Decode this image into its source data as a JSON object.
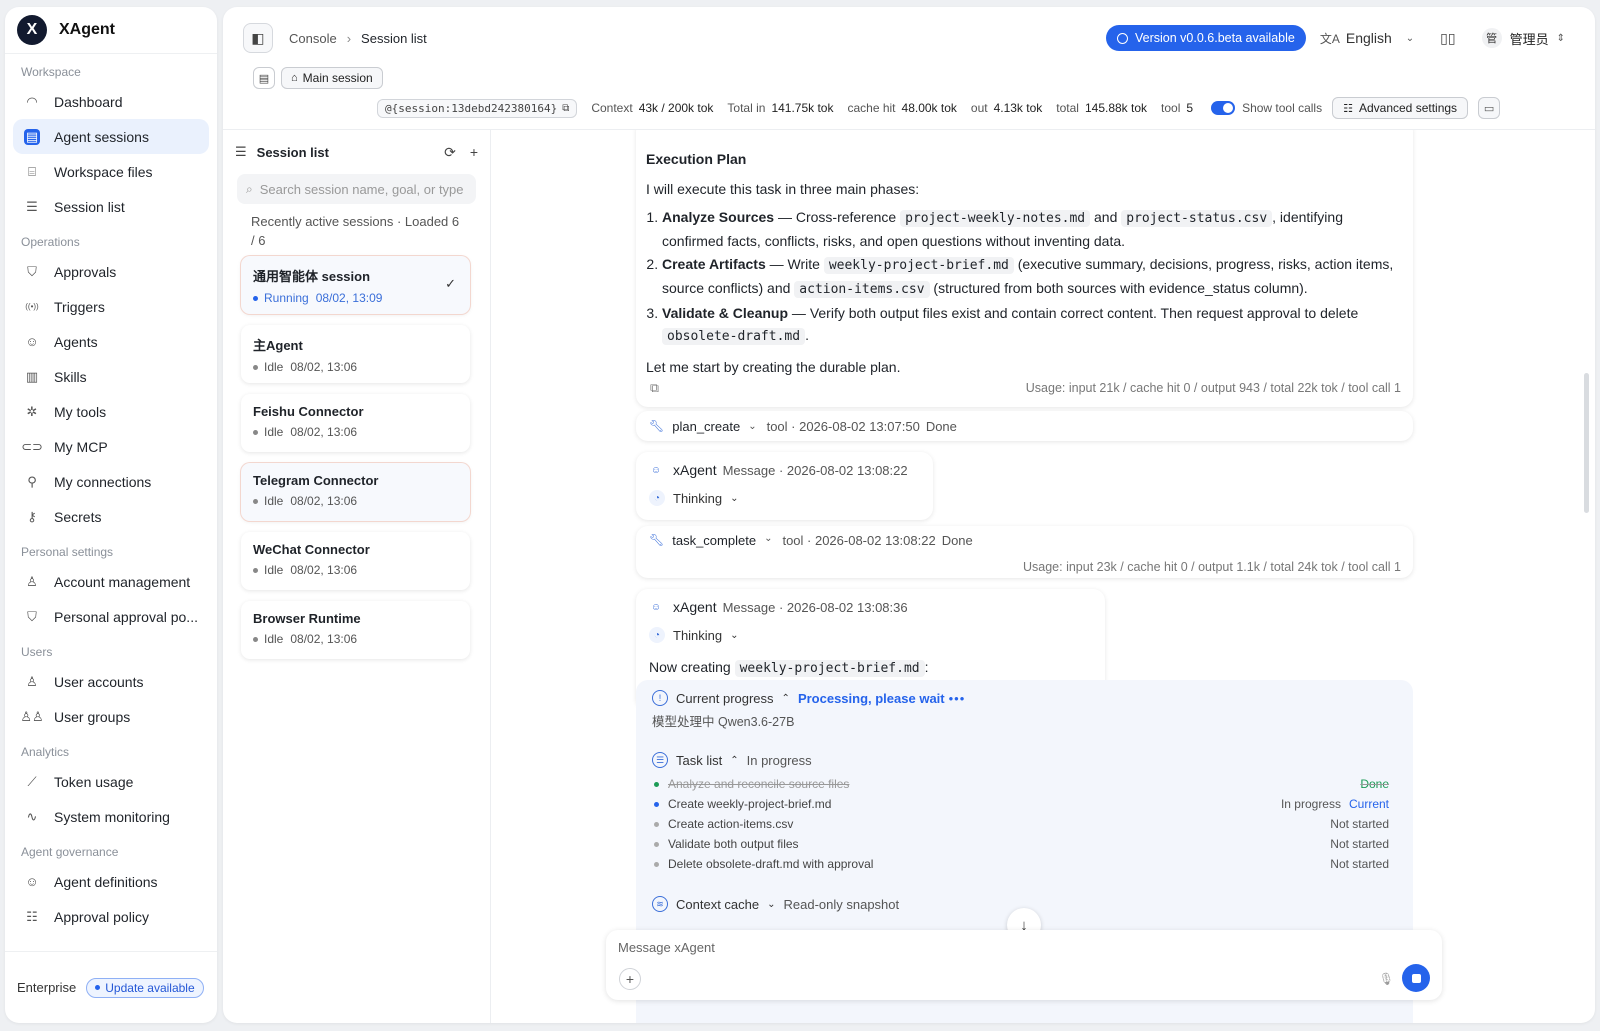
{
  "brand": {
    "name": "XAgent",
    "logo": "X"
  },
  "sidebar": {
    "sections": [
      {
        "title": "Workspace",
        "items": [
          {
            "label": "Dashboard",
            "icon": "dashboard-icon",
            "glyph": "◠"
          },
          {
            "label": "Agent sessions",
            "icon": "chat-icon",
            "glyph": "▤",
            "active": true
          },
          {
            "label": "Workspace files",
            "icon": "drive-icon",
            "glyph": "⌸"
          },
          {
            "label": "Session list",
            "icon": "list-icon",
            "glyph": "☰"
          }
        ]
      },
      {
        "title": "Operations",
        "items": [
          {
            "label": "Approvals",
            "icon": "shield-icon",
            "glyph": "⛉"
          },
          {
            "label": "Triggers",
            "icon": "broadcast-icon",
            "glyph": "((•))"
          },
          {
            "label": "Agents",
            "icon": "robot-icon",
            "glyph": "☺"
          },
          {
            "label": "Skills",
            "icon": "book-icon",
            "glyph": "▥"
          },
          {
            "label": "My tools",
            "icon": "tools-icon",
            "glyph": "✲"
          },
          {
            "label": "My MCP",
            "icon": "link-icon",
            "glyph": "⊂⊃"
          },
          {
            "label": "My connections",
            "icon": "plug-icon",
            "glyph": "⚲"
          },
          {
            "label": "Secrets",
            "icon": "key-icon",
            "glyph": "⚷"
          }
        ]
      },
      {
        "title": "Personal settings",
        "items": [
          {
            "label": "Account management",
            "icon": "user-gear-icon",
            "glyph": "♙"
          },
          {
            "label": "Personal approval po...",
            "icon": "shield-check-icon",
            "glyph": "⛉"
          }
        ]
      },
      {
        "title": "Users",
        "items": [
          {
            "label": "User accounts",
            "icon": "user-icon",
            "glyph": "♙"
          },
          {
            "label": "User groups",
            "icon": "users-icon",
            "glyph": "♙♙"
          }
        ]
      },
      {
        "title": "Analytics",
        "items": [
          {
            "label": "Token usage",
            "icon": "chart-line-icon",
            "glyph": "⟋"
          },
          {
            "label": "System monitoring",
            "icon": "pulse-icon",
            "glyph": "∿"
          }
        ]
      },
      {
        "title": "Agent governance",
        "items": [
          {
            "label": "Agent definitions",
            "icon": "bot-icon",
            "glyph": "☺"
          },
          {
            "label": "Approval policy",
            "icon": "sliders-icon",
            "glyph": "☷"
          }
        ]
      }
    ],
    "footer": {
      "edition": "Enterprise",
      "update": "Update available"
    }
  },
  "topbar": {
    "breadcrumb": [
      "Console",
      "Session list"
    ],
    "version_button": "Version v0.0.6.beta available",
    "language": "English",
    "user_avatar": "管",
    "user_name": "管理员"
  },
  "subbar": {
    "main_session": "Main session"
  },
  "stats": {
    "session_id": "@{session:13debd242380164}",
    "context_label": "Context",
    "context_value": "43k / 200k tok",
    "total_in_label": "Total  in",
    "total_in_value": "141.75k tok",
    "cache_label": "cache hit",
    "cache_value": "48.00k tok",
    "out_label": "out",
    "out_value": "4.13k tok",
    "total_label": "total",
    "total_value": "145.88k tok",
    "tool_label": "tool",
    "tool_value": "5",
    "show_tool_calls": "Show tool calls",
    "advanced": "Advanced settings"
  },
  "sessions": {
    "title": "Session list",
    "search_placeholder": "Search session name, goal, or type",
    "recent": "Recently active sessions · Loaded 6 / 6",
    "items": [
      {
        "name": "通用智能体 session",
        "status": "Running",
        "time": "08/02, 13:09",
        "running": true,
        "active": true
      },
      {
        "name": "主Agent",
        "status": "Idle",
        "time": "08/02, 13:06"
      },
      {
        "name": "Feishu Connector",
        "status": "Idle",
        "time": "08/02, 13:06"
      },
      {
        "name": "Telegram Connector",
        "status": "Idle",
        "time": "08/02, 13:06",
        "hover": true
      },
      {
        "name": "WeChat Connector",
        "status": "Idle",
        "time": "08/02, 13:06"
      },
      {
        "name": "Browser Runtime",
        "status": "Idle",
        "time": "08/02, 13:06"
      }
    ]
  },
  "chat": {
    "plan": {
      "title": "Execution Plan",
      "intro": "I will execute this task in three main phases:",
      "steps": [
        {
          "head": "Analyze Sources",
          "parts": [
            " — Cross-reference ",
            "project-weekly-notes.md",
            " and ",
            "project-status.csv",
            ", identifying confirmed facts, conflicts, risks, and open questions without inventing data."
          ]
        },
        {
          "head": "Create Artifacts",
          "parts": [
            " — Write ",
            "weekly-project-brief.md",
            " (executive summary, decisions, progress, risks, action items, source conflicts) and ",
            "action-items.csv",
            " (structured from both sources with evidence_status column)."
          ]
        },
        {
          "head": "Validate & Cleanup",
          "parts": [
            " — Verify both output files exist and contain correct content. Then request approval to delete ",
            "obsolete-draft.md",
            "."
          ]
        }
      ],
      "outro": "Let me start by creating the durable plan.",
      "usage": "Usage: input 21k / cache hit 0 / output 943 / total 22k tok / tool call 1"
    },
    "tool1": {
      "name": "plan_create",
      "meta": "tool · 2026-08-02 13:07:50",
      "status": "Done"
    },
    "msg1": {
      "name": "xAgent",
      "meta": "Message · 2026-08-02 13:08:22",
      "thinking": "Thinking"
    },
    "tool2": {
      "name": "task_complete",
      "meta": "tool · 2026-08-02 13:08:22",
      "status": "Done",
      "usage": "Usage: input 23k / cache hit 0 / output 1.1k / total 24k tok / tool call 1"
    },
    "msg2": {
      "name": "xAgent",
      "meta": "Message · 2026-08-02 13:08:36",
      "thinking": "Thinking",
      "text": "Now creating",
      "file": "weekly-project-brief.md",
      "tail": ":"
    },
    "progress": {
      "title": "Current progress",
      "state": "Processing, please wait",
      "model": "模型处理中 Qwen3.6-27B",
      "tasklist_title": "Task list",
      "tasklist_state": "In progress",
      "tasks": [
        {
          "label": "Analyze and reconcile source files",
          "status": "Done",
          "kind": "done"
        },
        {
          "label": "Create weekly-project-brief.md",
          "status": "In progress",
          "current": "Current",
          "kind": "cur"
        },
        {
          "label": "Create action-items.csv",
          "status": "Not started",
          "kind": "todo"
        },
        {
          "label": "Validate both output files",
          "status": "Not started",
          "kind": "todo"
        },
        {
          "label": "Delete obsolete-draft.md with approval",
          "status": "Not started",
          "kind": "todo"
        }
      ],
      "cache_title": "Context cache",
      "cache_state": "Read-only snapshot"
    },
    "composer_placeholder": "Message xAgent"
  },
  "colors": {
    "accent": "#2563eb",
    "done": "#1c9b56"
  }
}
